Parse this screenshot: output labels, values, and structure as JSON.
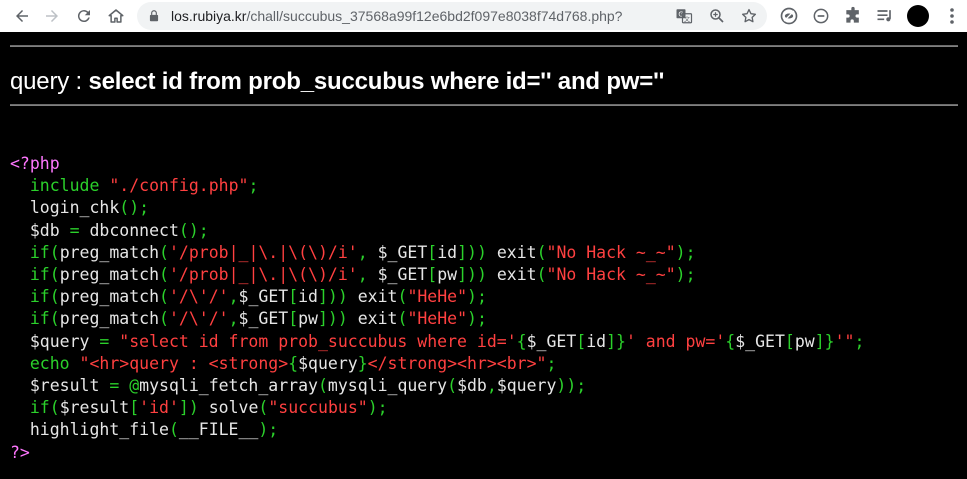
{
  "browser": {
    "url_host": "los.rubiya.kr",
    "url_path": "/chall/succubus_37568a99f12e6bd2f097e8038f74d768.php?"
  },
  "page": {
    "query_prefix": "query : ",
    "query_sql": "select id from prob_succubus where id='' and pw=''"
  },
  "code": {
    "lines": [
      [
        [
          "php",
          "<?php"
        ]
      ],
      [
        [
          "def",
          "  "
        ],
        [
          "kw",
          "include "
        ],
        [
          "str",
          "\"./config.php\""
        ],
        [
          "kw",
          ";"
        ]
      ],
      [
        [
          "def",
          "  login_chk"
        ],
        [
          "kw",
          "();"
        ]
      ],
      [
        [
          "def",
          "  $db "
        ],
        [
          "kw",
          "= "
        ],
        [
          "def",
          "dbconnect"
        ],
        [
          "kw",
          "();"
        ]
      ],
      [
        [
          "def",
          "  "
        ],
        [
          "kw",
          "if("
        ],
        [
          "def",
          "preg_match"
        ],
        [
          "kw",
          "("
        ],
        [
          "str",
          "'/prob|_|\\.|\\(\\)/i'"
        ],
        [
          "kw",
          ", "
        ],
        [
          "def",
          "$_GET"
        ],
        [
          "kw",
          "["
        ],
        [
          "def",
          "id"
        ],
        [
          "kw",
          "])) "
        ],
        [
          "def",
          "exit"
        ],
        [
          "kw",
          "("
        ],
        [
          "str",
          "\"No Hack ~_~\""
        ],
        [
          "kw",
          ");"
        ]
      ],
      [
        [
          "def",
          "  "
        ],
        [
          "kw",
          "if("
        ],
        [
          "def",
          "preg_match"
        ],
        [
          "kw",
          "("
        ],
        [
          "str",
          "'/prob|_|\\.|\\(\\)/i'"
        ],
        [
          "kw",
          ", "
        ],
        [
          "def",
          "$_GET"
        ],
        [
          "kw",
          "["
        ],
        [
          "def",
          "pw"
        ],
        [
          "kw",
          "])) "
        ],
        [
          "def",
          "exit"
        ],
        [
          "kw",
          "("
        ],
        [
          "str",
          "\"No Hack ~_~\""
        ],
        [
          "kw",
          ");"
        ]
      ],
      [
        [
          "def",
          "  "
        ],
        [
          "kw",
          "if("
        ],
        [
          "def",
          "preg_match"
        ],
        [
          "kw",
          "("
        ],
        [
          "str",
          "'/\\'/'"
        ],
        [
          "kw",
          ","
        ],
        [
          "def",
          "$_GET"
        ],
        [
          "kw",
          "["
        ],
        [
          "def",
          "id"
        ],
        [
          "kw",
          "])) "
        ],
        [
          "def",
          "exit"
        ],
        [
          "kw",
          "("
        ],
        [
          "str",
          "\"HeHe\""
        ],
        [
          "kw",
          ");"
        ]
      ],
      [
        [
          "def",
          "  "
        ],
        [
          "kw",
          "if("
        ],
        [
          "def",
          "preg_match"
        ],
        [
          "kw",
          "("
        ],
        [
          "str",
          "'/\\'/'"
        ],
        [
          "kw",
          ","
        ],
        [
          "def",
          "$_GET"
        ],
        [
          "kw",
          "["
        ],
        [
          "def",
          "pw"
        ],
        [
          "kw",
          "])) "
        ],
        [
          "def",
          "exit"
        ],
        [
          "kw",
          "("
        ],
        [
          "str",
          "\"HeHe\""
        ],
        [
          "kw",
          ");"
        ]
      ],
      [
        [
          "def",
          "  $query "
        ],
        [
          "kw",
          "= "
        ],
        [
          "str",
          "\"select id from prob_succubus where id='"
        ],
        [
          "kw",
          "{"
        ],
        [
          "def",
          "$_GET"
        ],
        [
          "kw",
          "["
        ],
        [
          "def",
          "id"
        ],
        [
          "kw",
          "]}"
        ],
        [
          "str",
          "' and pw='"
        ],
        [
          "kw",
          "{"
        ],
        [
          "def",
          "$_GET"
        ],
        [
          "kw",
          "["
        ],
        [
          "def",
          "pw"
        ],
        [
          "kw",
          "]}"
        ],
        [
          "str",
          "'\""
        ],
        [
          "kw",
          ";"
        ]
      ],
      [
        [
          "def",
          "  "
        ],
        [
          "kw",
          "echo "
        ],
        [
          "str",
          "\"<hr>query : <strong>"
        ],
        [
          "kw",
          "{"
        ],
        [
          "def",
          "$query"
        ],
        [
          "kw",
          "}"
        ],
        [
          "str",
          "</strong><hr><br>\""
        ],
        [
          "kw",
          ";"
        ]
      ],
      [
        [
          "def",
          "  $result "
        ],
        [
          "kw",
          "= @"
        ],
        [
          "def",
          "mysqli_fetch_array"
        ],
        [
          "kw",
          "("
        ],
        [
          "def",
          "mysqli_query"
        ],
        [
          "kw",
          "("
        ],
        [
          "def",
          "$db"
        ],
        [
          "kw",
          ","
        ],
        [
          "def",
          "$query"
        ],
        [
          "kw",
          "));"
        ]
      ],
      [
        [
          "def",
          "  "
        ],
        [
          "kw",
          "if("
        ],
        [
          "def",
          "$result"
        ],
        [
          "kw",
          "["
        ],
        [
          "str",
          "'id'"
        ],
        [
          "kw",
          "]) "
        ],
        [
          "def",
          "solve"
        ],
        [
          "kw",
          "("
        ],
        [
          "str",
          "\"succubus\""
        ],
        [
          "kw",
          ");"
        ]
      ],
      [
        [
          "def",
          "  highlight_file"
        ],
        [
          "kw",
          "("
        ],
        [
          "def",
          "__FILE__"
        ],
        [
          "kw",
          ");"
        ]
      ],
      [
        [
          "php",
          "?>"
        ]
      ]
    ]
  }
}
